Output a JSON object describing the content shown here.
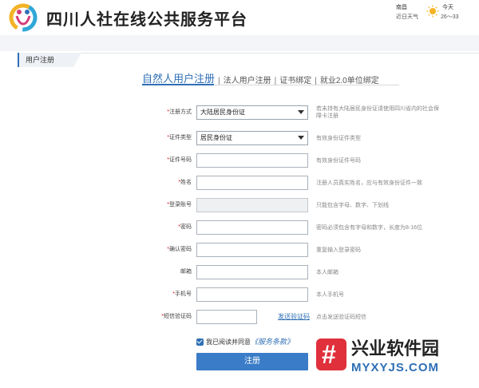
{
  "header": {
    "site_title": "四川人社在线公共服务平台",
    "logo_icon": "human-resources-logo-icon",
    "weather": {
      "city": "南昌",
      "recent_label": "近日天气",
      "today_label": "今天",
      "temperature": "26～33",
      "icon": "sun-icon"
    }
  },
  "panel": {
    "title": "用户注册"
  },
  "tabs": [
    {
      "label": "自然人用户注册",
      "active": true
    },
    {
      "label": "法人用户注册",
      "active": false
    },
    {
      "label": "证书绑定",
      "active": false
    },
    {
      "label": "就业2.0单位绑定",
      "active": false
    }
  ],
  "tab_separator": "|",
  "form": {
    "register_method": {
      "label": "注册方式",
      "value": "大陆居民身份证",
      "hint": "若未持有大陆居民身份证请使用四川省内的社会保障卡注册"
    },
    "id_type": {
      "label": "证件类型",
      "value": "居民身份证",
      "hint": "有效身份证件类型"
    },
    "id_number": {
      "label": "证件号码",
      "value": "",
      "hint": "有效身份证件号码"
    },
    "name": {
      "label": "姓名",
      "value": "",
      "hint": "注册人员真实姓名，应与有效身份证件一致"
    },
    "login_account": {
      "label": "登录账号",
      "value": "",
      "hint": "只能包含字母、数字、下划线"
    },
    "password": {
      "label": "密码",
      "value": "",
      "hint": "密码必须包含有字母和数字，长度为8-16位"
    },
    "confirm_password": {
      "label": "确认密码",
      "value": "",
      "hint": "重复输入登录密码"
    },
    "email": {
      "label": "邮箱",
      "value": "",
      "hint": "本人邮箱"
    },
    "phone": {
      "label": "手机号",
      "value": "",
      "hint": "本人手机号"
    },
    "sms_code": {
      "label": "短信验证码",
      "value": "",
      "hint": "点击发送验证码短信",
      "send_label": "发送验证码"
    },
    "required_mark": "*",
    "agree": {
      "checked": true,
      "text": "我已阅读并同意",
      "link": "《服务条款》"
    },
    "submit_label": "注册"
  },
  "watermark": {
    "badge": "#",
    "cn": "兴业软件园",
    "en": "MYXYJS.COM"
  },
  "colors": {
    "accent": "#2f6fb5",
    "button": "#3a7cc8",
    "required": "#d9161a",
    "watermark_red": "#e0303b"
  }
}
